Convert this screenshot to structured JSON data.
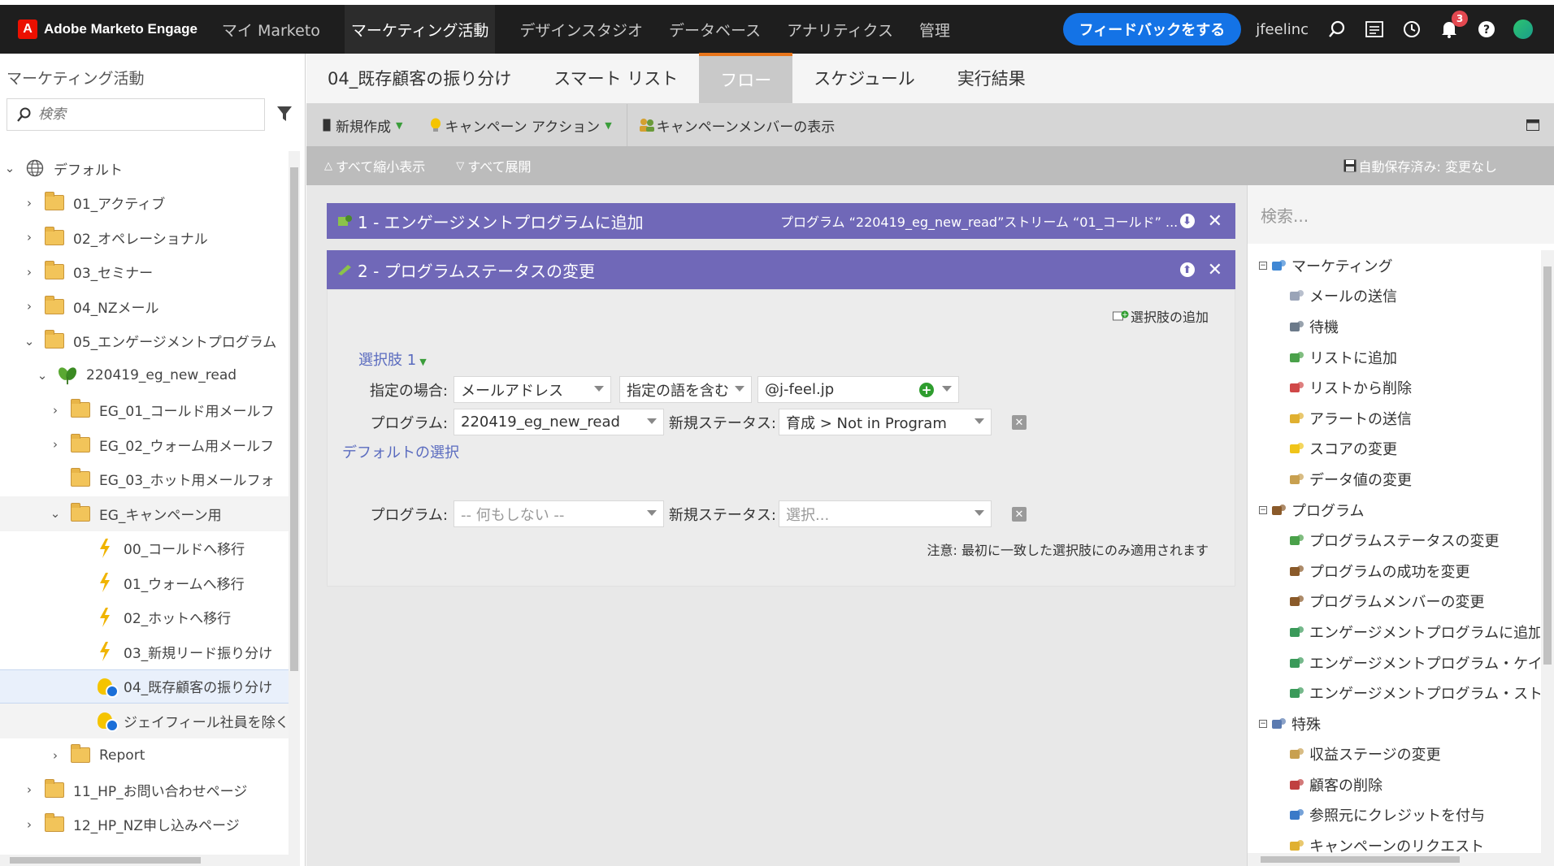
{
  "topnav": {
    "logo": "Adobe Marketo Engage",
    "items": [
      "マイ Marketo",
      "マーケティング活動",
      "デザインスタジオ",
      "データベース",
      "アナリティクス",
      "管理"
    ],
    "active_index": 1,
    "feedback": "フィードバックをする",
    "user": "jfeelinc",
    "notification_count": "3",
    "icons": [
      "search-icon",
      "tasks-icon",
      "history-icon",
      "bell-icon",
      "help-icon",
      "avatar"
    ]
  },
  "left": {
    "title": "マーケティング活動",
    "search_placeholder": "検索",
    "tree": [
      {
        "label": "デフォルト",
        "indent": 0,
        "chev": "⌄",
        "icon": "globe"
      },
      {
        "label": "01_アクティブ",
        "indent": 1,
        "chev": "›",
        "icon": "folder"
      },
      {
        "label": "02_オペレーショナル",
        "indent": 1,
        "chev": "›",
        "icon": "folder"
      },
      {
        "label": "03_セミナー",
        "indent": 1,
        "chev": "›",
        "icon": "folder"
      },
      {
        "label": "04_NZメール",
        "indent": 1,
        "chev": "›",
        "icon": "folder"
      },
      {
        "label": "05_エンゲージメントプログラム",
        "indent": 1,
        "chev": "⌄",
        "icon": "folder"
      },
      {
        "label": "220419_eg_new_read",
        "indent": 2,
        "chev": "⌄",
        "icon": "engagement"
      },
      {
        "label": "EG_01_コールド用メールフ",
        "indent": 3,
        "chev": "›",
        "icon": "folder"
      },
      {
        "label": "EG_02_ウォーム用メールフ",
        "indent": 3,
        "chev": "›",
        "icon": "folder"
      },
      {
        "label": "EG_03_ホット用メールフォ",
        "indent": 3,
        "chev": "",
        "icon": "folder"
      },
      {
        "label": "EG_キャンペーン用",
        "indent": 3,
        "chev": "⌄",
        "icon": "folder",
        "grey": true
      },
      {
        "label": "00_コールドへ移行",
        "indent": 4,
        "chev": "",
        "icon": "bolt"
      },
      {
        "label": "01_ウォームへ移行",
        "indent": 4,
        "chev": "",
        "icon": "bolt"
      },
      {
        "label": "02_ホットへ移行",
        "indent": 4,
        "chev": "",
        "icon": "bolt"
      },
      {
        "label": "03_新規リード振り分け",
        "indent": 4,
        "chev": "",
        "icon": "bolt"
      },
      {
        "label": "04_既存顧客の振り分け",
        "indent": 4,
        "chev": "",
        "icon": "bulb",
        "selected": true
      },
      {
        "label": "ジェイフィール社員を除く",
        "indent": 4,
        "chev": "",
        "icon": "bulb",
        "grey": true
      },
      {
        "label": "Report",
        "indent": 3,
        "chev": "›",
        "icon": "folder"
      },
      {
        "label": "11_HP_お問い合わせページ",
        "indent": 1,
        "chev": "›",
        "icon": "folder"
      },
      {
        "label": "12_HP_NZ申し込みページ",
        "indent": 1,
        "chev": "›",
        "icon": "folder"
      }
    ]
  },
  "tabs": [
    "04_既存顧客の振り分け",
    "スマート リスト",
    "フロー",
    "スケジュール",
    "実行結果"
  ],
  "active_tab": 2,
  "toolbar": {
    "new": "新規作成",
    "campaign_action": "キャンペーン アクション",
    "members": "キャンペーンメンバーの表示"
  },
  "subbar": {
    "collapse": "すべて縮小表示",
    "expand": "すべて展開",
    "autosave": "自動保存済み: 変更なし"
  },
  "flow": {
    "step1": {
      "title": "1 - エンゲージメントプログラムに追加",
      "summary": "プログラム “220419_eg_new_read”ストリーム “01_コールド” ..."
    },
    "step2": {
      "title": "2 - プログラムステータスの変更",
      "add_choice": "選択肢の追加",
      "choice1_title": "選択肢 1",
      "if_label": "指定の場合:",
      "if_field": "メールアドレス",
      "if_operator": "指定の語を含む",
      "if_value": "@j-feel.jp",
      "program_label": "プログラム:",
      "program_value": "220419_eg_new_read",
      "status_label": "新規ステータス:",
      "status_value": "育成 > Not in Program",
      "default_title": "デフォルトの選択",
      "default_program_label": "プログラム:",
      "default_program_value": "-- 何もしない --",
      "default_status_label": "新規ステータス:",
      "default_status_value": "選択...",
      "note": "注意: 最初に一致した選択肢にのみ適用されます"
    }
  },
  "palette": {
    "search_placeholder": "検索...",
    "items": [
      {
        "label": "マーケティング",
        "cat": true,
        "color": "#3f87d4"
      },
      {
        "label": "メールの送信",
        "cat": false,
        "color": "#9aa4b8"
      },
      {
        "label": "待機",
        "cat": false,
        "color": "#6c7a8a"
      },
      {
        "label": "リストに追加",
        "cat": false,
        "color": "#4aa14a"
      },
      {
        "label": "リストから削除",
        "cat": false,
        "color": "#d04848"
      },
      {
        "label": "アラートの送信",
        "cat": false,
        "color": "#e0b030"
      },
      {
        "label": "スコアの変更",
        "cat": false,
        "color": "#f0c419"
      },
      {
        "label": "データ値の変更",
        "cat": false,
        "color": "#c8a050"
      },
      {
        "label": "プログラム",
        "cat": true,
        "color": "#8a5a2a"
      },
      {
        "label": "プログラムステータスの変更",
        "cat": false,
        "color": "#4aa14a"
      },
      {
        "label": "プログラムの成功を変更",
        "cat": false,
        "color": "#8a5a2a"
      },
      {
        "label": "プログラムメンバーの変更",
        "cat": false,
        "color": "#8a5a2a"
      },
      {
        "label": "エンゲージメントプログラムに追加",
        "cat": false,
        "color": "#3a9a5a"
      },
      {
        "label": "エンゲージメントプログラム・ケイ",
        "cat": false,
        "color": "#3a9a5a"
      },
      {
        "label": "エンゲージメントプログラム・スト",
        "cat": false,
        "color": "#3a9a5a"
      },
      {
        "label": "特殊",
        "cat": true,
        "color": "#5a7ab0"
      },
      {
        "label": "収益ステージの変更",
        "cat": false,
        "color": "#c8a050"
      },
      {
        "label": "顧客の削除",
        "cat": false,
        "color": "#c04040"
      },
      {
        "label": "参照元にクレジットを付与",
        "cat": false,
        "color": "#3a7ac8"
      },
      {
        "label": "キャンペーンのリクエスト",
        "cat": false,
        "color": "#e0b030"
      }
    ]
  }
}
